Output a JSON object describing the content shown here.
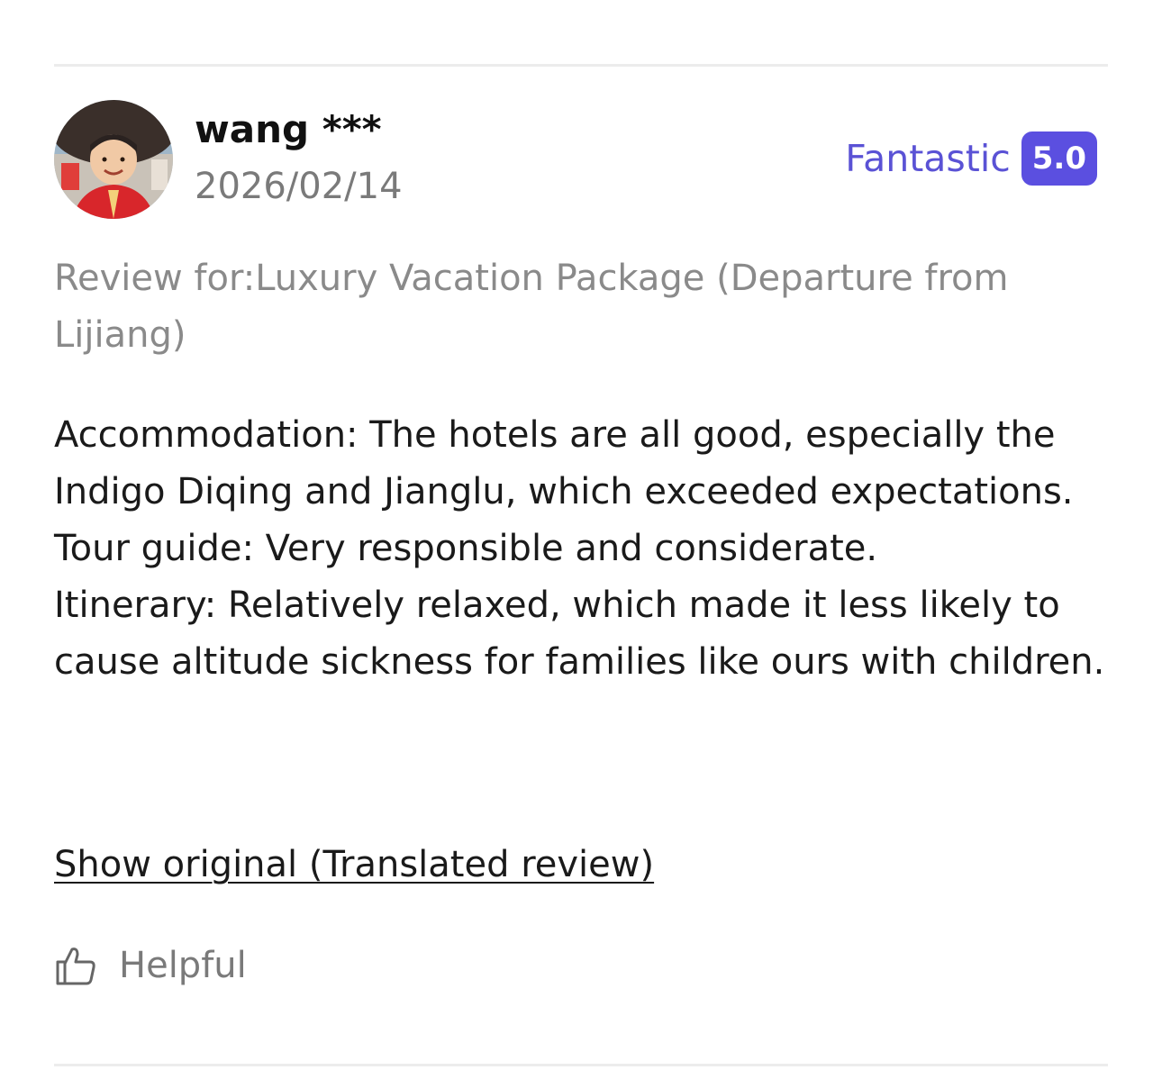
{
  "review": {
    "user_name": "wang ***",
    "date": "2026/02/14",
    "rating_label": "Fantastic",
    "rating_score": "5.0",
    "review_for": "Review for:Luxury Vacation Package (Departure from Lijiang)",
    "body_lines": [
      "Accommodation: The hotels are all good, especially the Indigo Diqing and Jianglu, which exceeded expectations.",
      "Tour guide: Very responsible and considerate.",
      "Itinerary: Relatively relaxed, which made it less likely to cause altitude sickness for families like ours with children."
    ],
    "show_original_label": "Show original (Translated review)",
    "helpful_label": "Helpful",
    "helpful_icon": "thumbs-up-icon"
  },
  "colors": {
    "accent": "#5a52d5",
    "badge_bg": "#5b4fe0",
    "muted_text": "#7a7a7a",
    "divider": "#ececec"
  }
}
